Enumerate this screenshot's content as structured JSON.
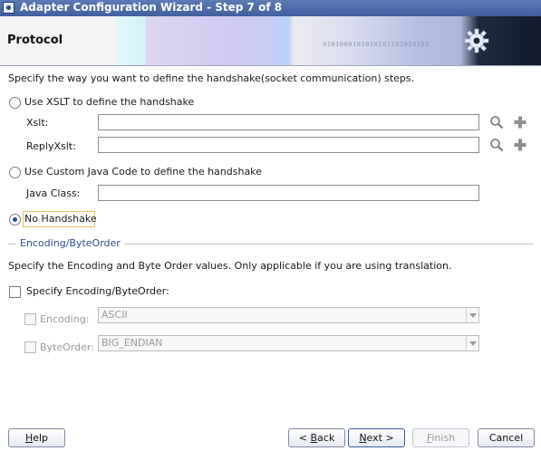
{
  "window": {
    "title": "Adapter Configuration Wizard - Step 7 of 8"
  },
  "banner": {
    "title": "Protocol",
    "bits_text": "0101000101010101101010101"
  },
  "intro": "Specify the way you want to define the handshake(socket communication) steps.",
  "handshake": {
    "xslt_option": "Use XSLT to define the handshake",
    "xslt_label": "Xslt:",
    "xslt_value": "",
    "replyxslt_label": "ReplyXslt:",
    "replyxslt_value": "",
    "java_option": "Use Custom Java Code to define the handshake",
    "java_class_label": "Java Class:",
    "java_class_value": "",
    "none_option": "No Handshake",
    "selected": "No Handshake"
  },
  "encoding_section": {
    "title": "Encoding/ByteOrder",
    "description": "Specify the Encoding and Byte Order values. Only applicable if you are using translation.",
    "specify_label": "Specify Encoding/ByteOrder:",
    "specify_checked": false,
    "encoding_label": "Encoding:",
    "encoding_value": "ASCII",
    "byteorder_label": "ByteOrder:",
    "byteorder_value": "BIG_ENDIAN"
  },
  "buttons": {
    "help_pre": "",
    "help_key": "H",
    "help_post": "elp",
    "back_pre": "< ",
    "back_key": "B",
    "back_post": "ack",
    "next_pre": "",
    "next_key": "N",
    "next_post": "ext >",
    "finish_pre": "",
    "finish_key": "F",
    "finish_post": "inish",
    "cancel_label": "Cancel"
  },
  "colors": {
    "title_bar": "#4a69a8",
    "accent": "#3a5da8",
    "focus": "#e6c066"
  },
  "icons": [
    "search-icon",
    "add-icon",
    "gear-icon",
    "window-menu-icon",
    "close-icon"
  ]
}
